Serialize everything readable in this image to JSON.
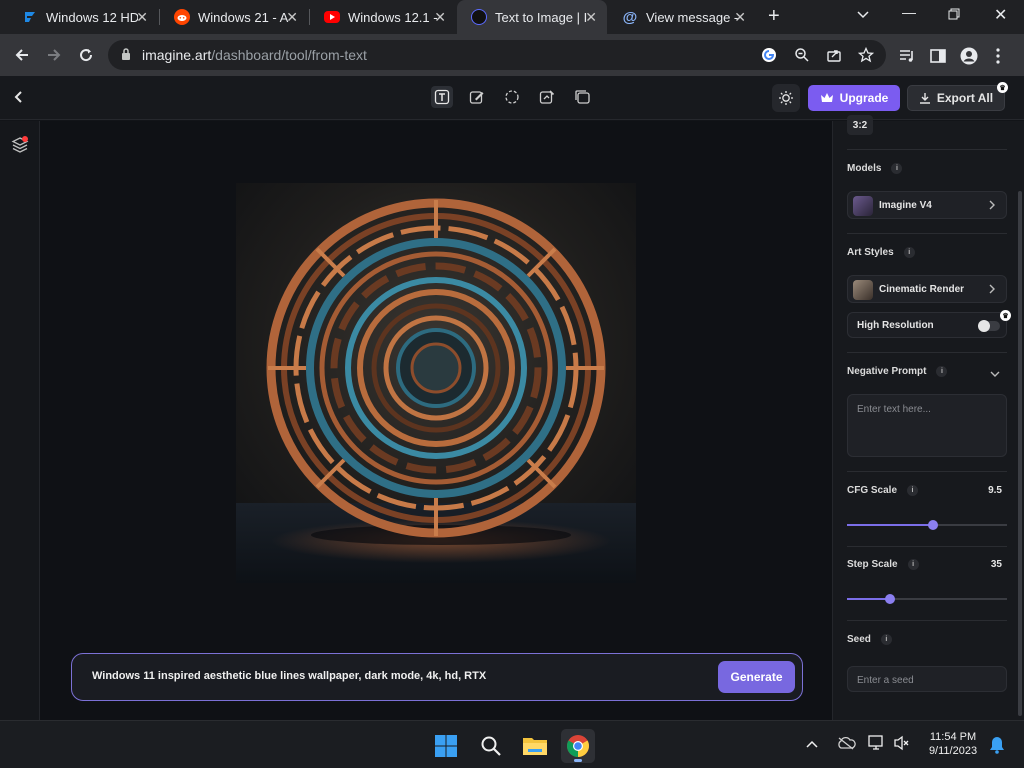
{
  "browser": {
    "tabs": [
      {
        "title": "Windows 12 HD",
        "favicon": "windows-blue-logo"
      },
      {
        "title": "Windows 21 - A",
        "favicon": "reddit-logo"
      },
      {
        "title": "Windows 12.1 -",
        "favicon": "youtube-logo"
      },
      {
        "title": "Text to Image | I",
        "favicon": "imagine-art-logo",
        "active": true
      },
      {
        "title": "View message -",
        "favicon": "at-sign-logo"
      }
    ],
    "url_domain": "imagine.art",
    "url_path": "/dashboard/tool/from-text"
  },
  "header": {
    "upgrade_label": "Upgrade",
    "export_label": "Export All"
  },
  "prompt": {
    "text": "Windows 11 inspired aesthetic blue lines wallpaper, dark mode, 4k, hd, RTX",
    "generate_label": "Generate"
  },
  "panel": {
    "aspect_ratio": "3:2",
    "models_label": "Models",
    "model_value": "Imagine V4",
    "art_styles_label": "Art Styles",
    "art_style_value": "Cinematic Render",
    "high_resolution_label": "High Resolution",
    "negative_prompt_label": "Negative Prompt",
    "negative_prompt_placeholder": "Enter text here...",
    "cfg_scale_label": "CFG Scale",
    "cfg_scale_value": "9.5",
    "cfg_scale_fraction": 0.54,
    "step_scale_label": "Step Scale",
    "step_scale_value": "35",
    "step_scale_fraction": 0.27,
    "seed_label": "Seed",
    "seed_placeholder": "Enter a seed"
  },
  "taskbar": {
    "time": "11:54 PM",
    "date": "9/11/2023"
  },
  "colors": {
    "accent": "#7b5cf0",
    "generate": "#7868e0",
    "slider": "#8b7ff0"
  }
}
